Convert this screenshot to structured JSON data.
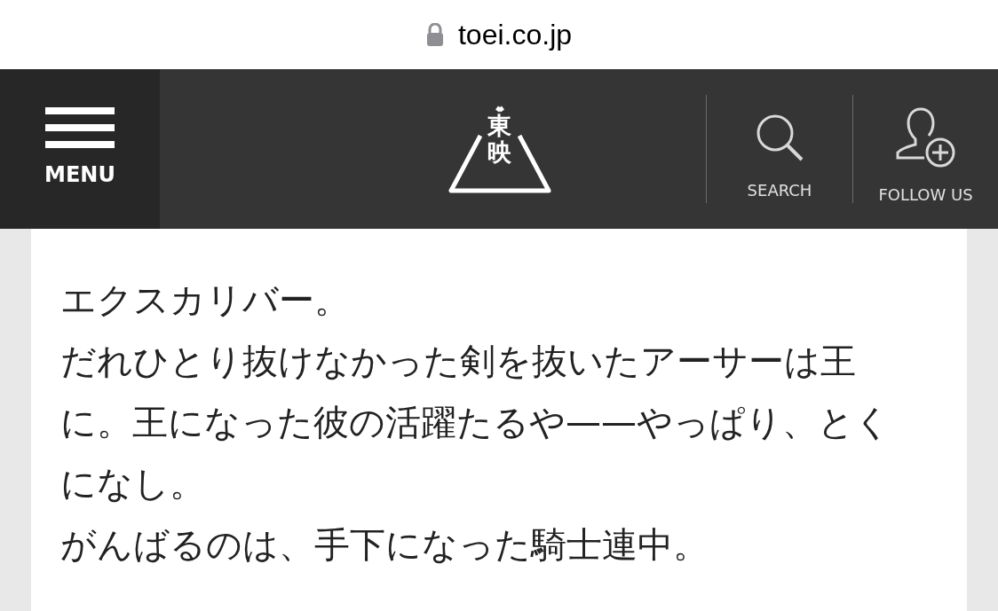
{
  "address_bar": {
    "url": "toei.co.jp"
  },
  "header": {
    "menu_label": "MENU",
    "logo_text": "東映",
    "actions": [
      {
        "kind": "search",
        "label": "SEARCH"
      },
      {
        "kind": "follow",
        "label": "FOLLOW US"
      }
    ]
  },
  "article": {
    "paragraphs": [
      "エクスカリバー。",
      "だれひとり抜けなかった剣を抜いたアーサーは王に。王になった彼の活躍たるや——やっぱり、とくになし。",
      "がんばるのは、手下になった騎士連中。"
    ]
  }
}
